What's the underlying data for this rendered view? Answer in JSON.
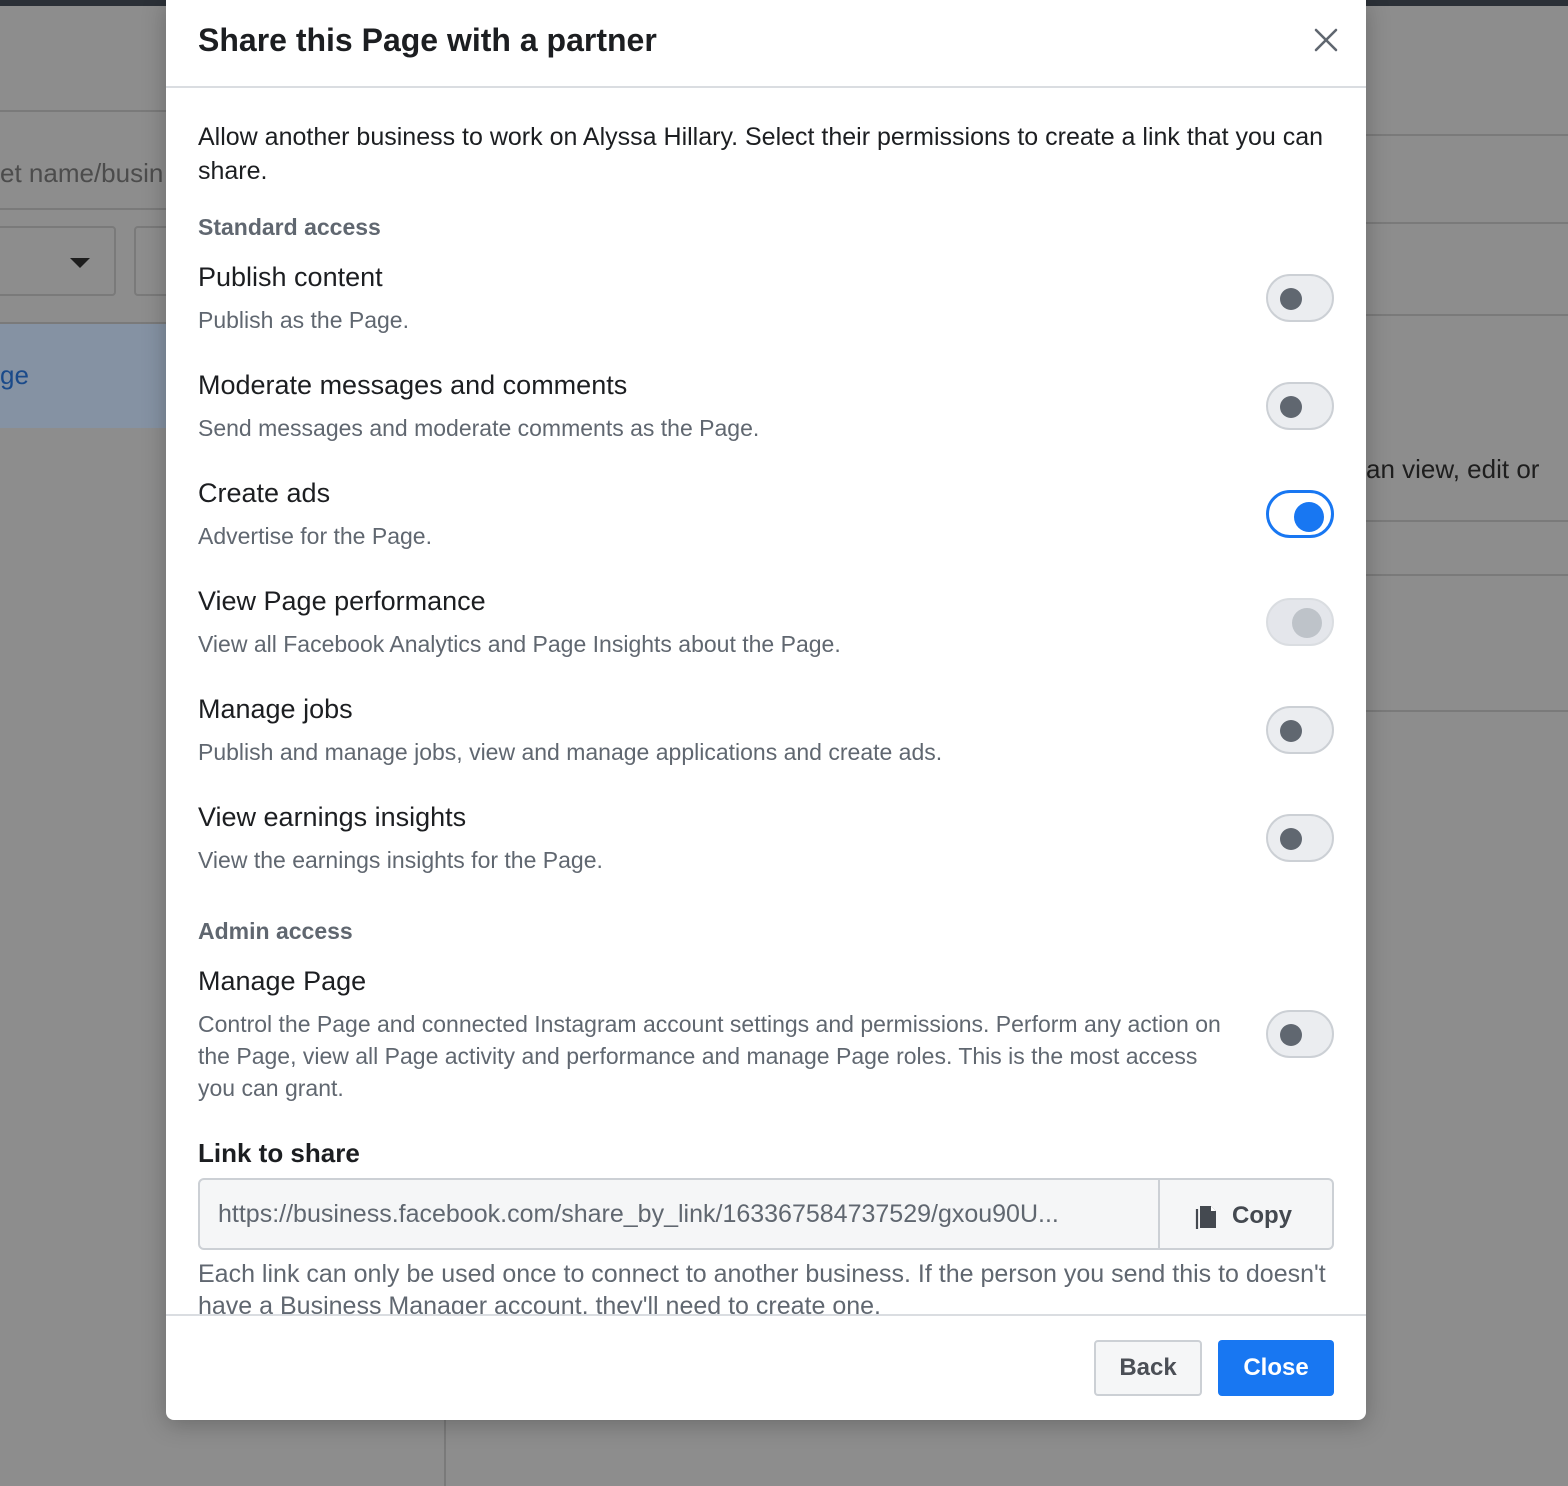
{
  "background": {
    "search_text": "et name/busin",
    "link_text": "ge",
    "right_text": "an view, edit or"
  },
  "modal": {
    "title": "Share this Page with a partner",
    "intro": "Allow another business to work on Alyssa Hillary. Select their permissions to create a link that you can share.",
    "standard_section": "Standard access",
    "admin_section": "Admin access",
    "permissions": [
      {
        "name": "Publish content",
        "description": "Publish as the Page.",
        "state": "off"
      },
      {
        "name": "Moderate messages and comments",
        "description": "Send messages and moderate comments as the Page.",
        "state": "off"
      },
      {
        "name": "Create ads",
        "description": "Advertise for the Page.",
        "state": "on"
      },
      {
        "name": "View Page performance",
        "description": "View all Facebook Analytics and Page Insights about the Page.",
        "state": "on-disabled"
      },
      {
        "name": "Manage jobs",
        "description": "Publish and manage jobs, view and manage applications and create ads.",
        "state": "off"
      },
      {
        "name": "View earnings insights",
        "description": "View the earnings insights for the Page.",
        "state": "off"
      }
    ],
    "admin_permission": {
      "name": "Manage Page",
      "description": "Control the Page and connected Instagram account settings and permissions. Perform any action on the Page, view all Page activity and performance and manage Page roles. This is the most access you can grant.",
      "state": "off"
    },
    "link_label": "Link to share",
    "link_value": "https://business.facebook.com/share_by_link/163367584737529/gxou90U...",
    "copy_label": "Copy",
    "footnote": "Each link can only be used once to connect to another business. If the person you send this to doesn't have a Business Manager account, they'll need to create one.",
    "back_label": "Back",
    "close_label": "Close"
  },
  "colors": {
    "accent": "#1877f2",
    "toggle_off_knob": "#606770",
    "overlay": "#8d8d8d"
  }
}
